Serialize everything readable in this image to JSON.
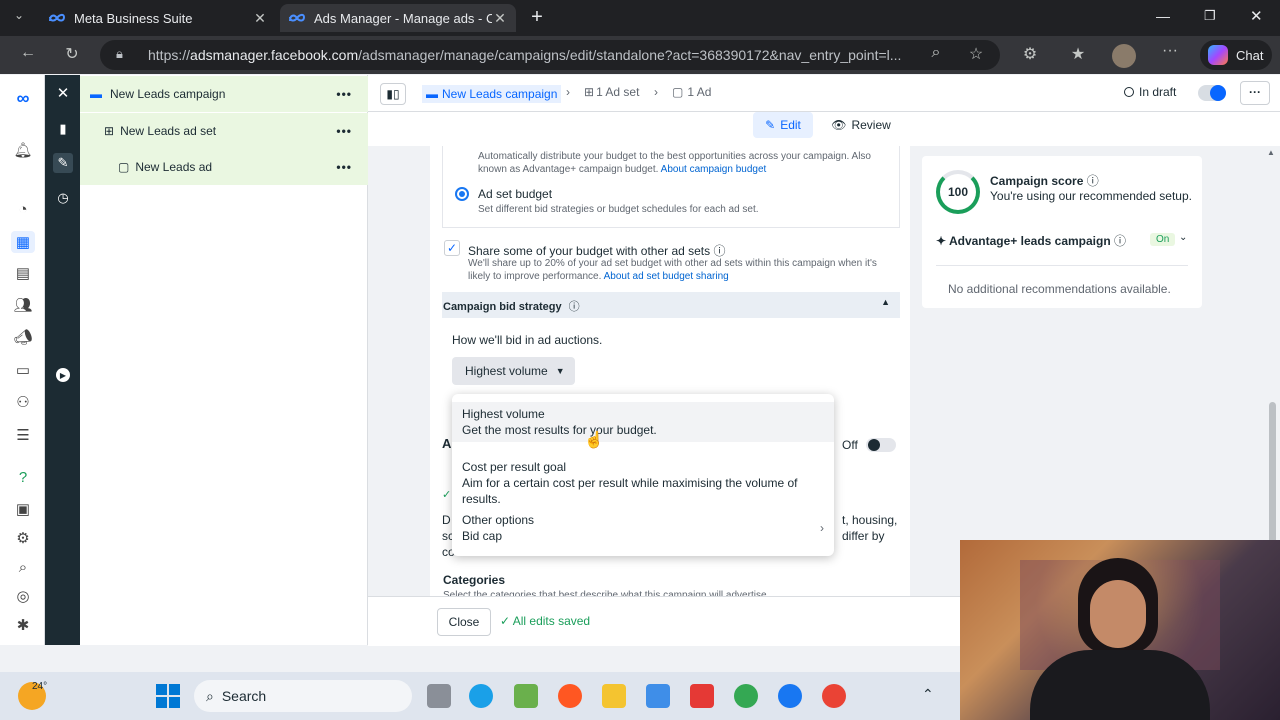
{
  "browser": {
    "tabs": [
      {
        "title": "Meta Business Suite",
        "active": false
      },
      {
        "title": "Ads Manager - Manage ads - Cam",
        "active": true
      }
    ],
    "url_prefix": "https://",
    "url_domain": "adsmanager.facebook.com",
    "url_path": "/adsmanager/manage/campaigns/edit/standalone?act=368390172&nav_entry_point=l...",
    "copilot_label": "Chat"
  },
  "tree": {
    "campaign": "New Leads campaign",
    "adset": "New Leads ad set",
    "ad": "New Leads ad"
  },
  "topbar": {
    "crumb_campaign": "New Leads campaign",
    "crumb_adset": "1 Ad set",
    "crumb_ad": "1 Ad",
    "status": "In draft",
    "edit_label": "Edit",
    "review_label": "Review"
  },
  "budget": {
    "cbo_desc": "Automatically distribute your budget to the best opportunities across your campaign. Also known as Advantage+ campaign budget.",
    "cbo_link": "About campaign budget",
    "adset_title": "Ad set budget",
    "adset_desc": "Set different bid strategies or budget schedules for each ad set.",
    "share_title": "Share some of your budget with other ad sets",
    "share_desc": "We'll share up to 20% of your ad set budget with other ad sets within this campaign when it's likely to improve performance.",
    "share_link": "About ad set budget sharing"
  },
  "bid": {
    "section_title": "Campaign bid strategy",
    "how": "How we'll bid in ad auctions.",
    "selected": "Highest volume",
    "options": [
      {
        "title": "Highest volume",
        "desc": "Get the most results for your budget."
      },
      {
        "title": "Cost per result goal",
        "desc": "Aim for a certain cost per result while maximising the volume of results."
      },
      {
        "title": "Other options",
        "desc": "Bid cap"
      }
    ]
  },
  "behind": {
    "ab_letter": "A",
    "ab_toggle": "Off",
    "d_letter": "D",
    "s_letter": "sc",
    "c_letter": "co",
    "right_text1": "t, housing,",
    "right_text2": "differ by",
    "categories_title": "Categories",
    "categories_desc": "Select the categories that best describe what this campaign will advertise."
  },
  "score": {
    "value": "100",
    "title": "Campaign score",
    "desc": "You're using our recommended setup.",
    "adv_label": "Advantage+ leads campaign",
    "adv_state": "On",
    "no_recs": "No additional recommendations available."
  },
  "footer": {
    "close_label": "Close",
    "saved_label": "All edits saved"
  },
  "taskbar": {
    "weather": "24°",
    "search": "Search"
  }
}
